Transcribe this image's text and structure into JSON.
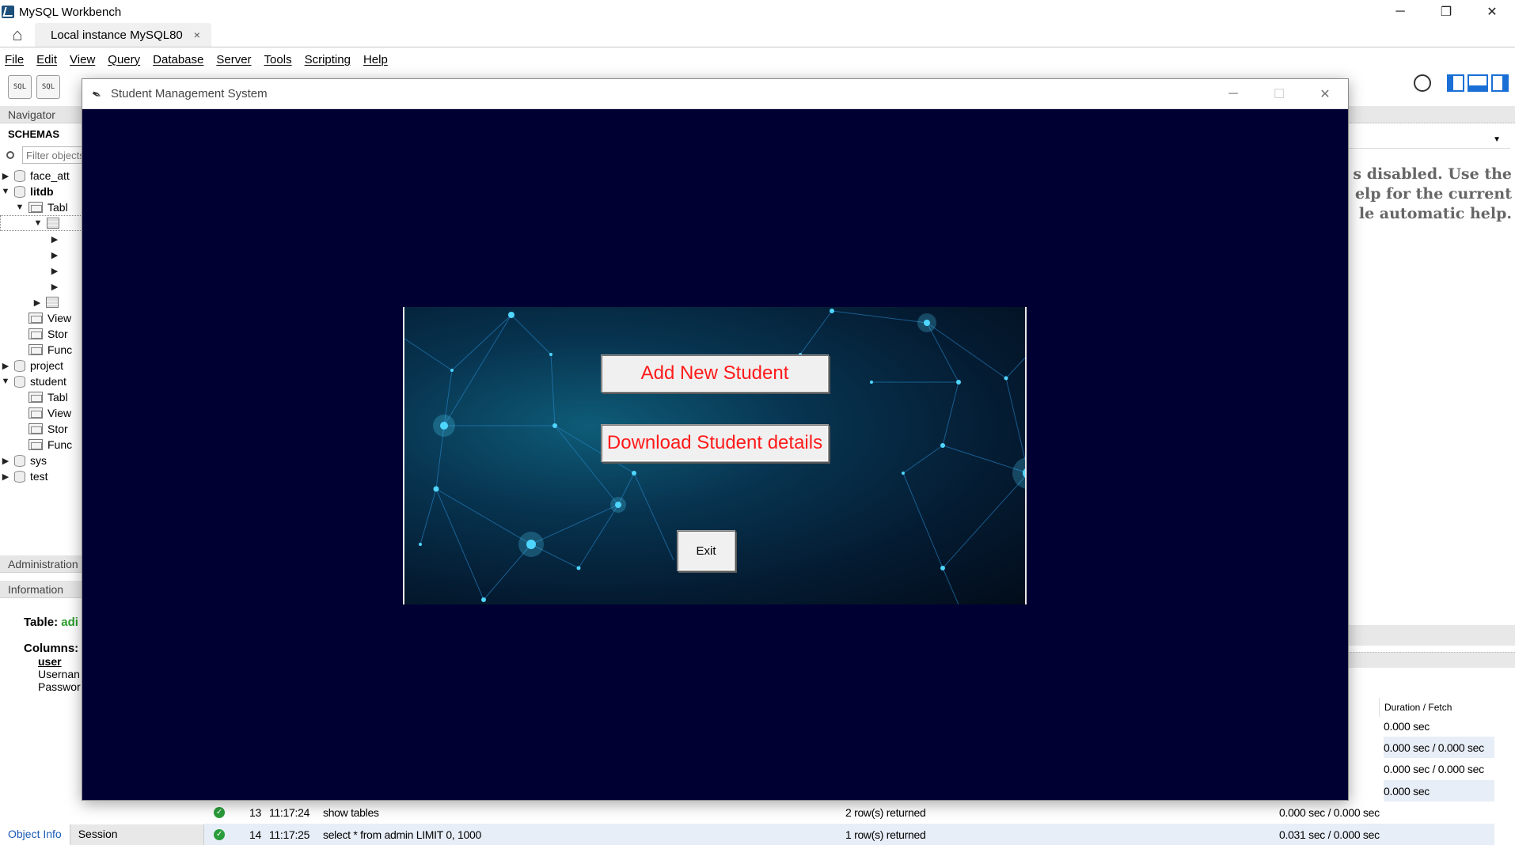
{
  "workbench": {
    "title": "MySQL Workbench",
    "window_controls": {
      "minimize": "─",
      "restore": "❐",
      "close": "✕"
    },
    "home_icon": "⌂",
    "connection_tab": {
      "label": "Local instance MySQL80",
      "close": "×"
    },
    "menu": [
      "File",
      "Edit",
      "View",
      "Query",
      "Database",
      "Server",
      "Tools",
      "Scripting",
      "Help"
    ],
    "toolbar": {
      "sql1": "SQL",
      "sql2": "SQL"
    }
  },
  "sidebar": {
    "navigator_label": "Navigator",
    "schemas_label": "SCHEMAS",
    "filter_placeholder": "Filter objects",
    "tree": {
      "face_att": "face_att",
      "litdb": "litdb",
      "tables1": "Tabl",
      "views1": "View",
      "stored1": "Stor",
      "functions1": "Func",
      "project": "project",
      "student": "student",
      "tables2": "Tabl",
      "views2": "View",
      "stored2": "Stor",
      "functions2": "Func",
      "sys": "sys",
      "test": "test"
    },
    "administration_label": "Administration",
    "information_label": "Information",
    "info": {
      "table_label": "Table:",
      "table_value": "adi",
      "columns_label": "Columns:",
      "col_user": "user",
      "col_username": "Usernan",
      "col_password": "Passwor"
    },
    "footer_tabs": {
      "object_info": "Object Info",
      "session": "Session"
    }
  },
  "right_pane": {
    "help_line1": "s disabled. Use the",
    "help_line2": "elp for the current",
    "help_line3": "le automatic help."
  },
  "output": {
    "duration_header": "Duration / Fetch",
    "extra_durations": [
      "0.000 sec",
      "0.000 sec / 0.000 sec",
      "0.000 sec / 0.000 sec",
      "0.000 sec"
    ],
    "rows": [
      {
        "num": "13",
        "time": "11:17:24",
        "action": "show tables",
        "message": "2 row(s) returned",
        "duration": "0.000 sec / 0.000 sec"
      },
      {
        "num": "14",
        "time": "11:17:25",
        "action": "select * from admin LIMIT 0, 1000",
        "message": "1 row(s) returned",
        "duration": "0.031 sec / 0.000 sec"
      }
    ]
  },
  "popup": {
    "title": "Student Management System",
    "window_controls": {
      "minimize": "─",
      "maximize": "☐",
      "close": "✕"
    },
    "buttons": {
      "add_student": "Add New Student",
      "download_details": "Download Student details",
      "exit": "Exit"
    },
    "colors": {
      "background": "#000033",
      "button_text": "#ff1a1a"
    }
  }
}
